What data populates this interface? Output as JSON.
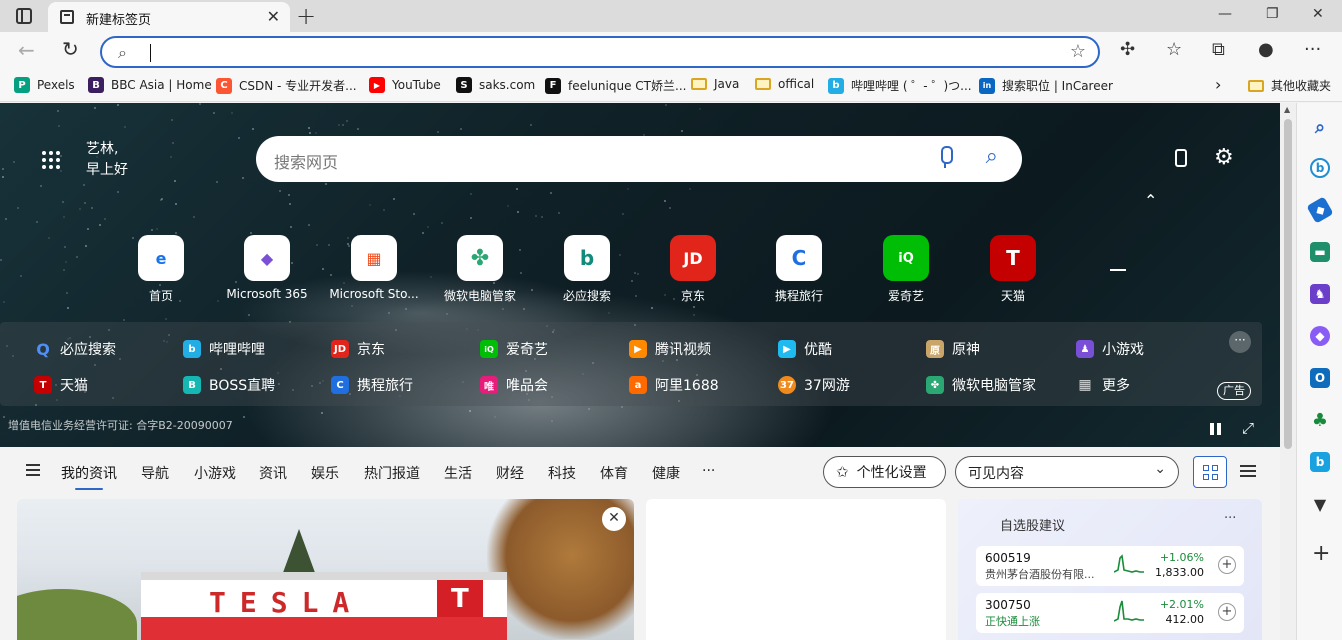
{
  "browser": {
    "tab_title": "新建标签页",
    "new_tab_glyph": "+",
    "close_glyph": "✕",
    "window_controls": {
      "minimize": "—",
      "restore": "❐",
      "close": "✕"
    },
    "address_value": ""
  },
  "bookmarks": [
    {
      "label": "Pexels",
      "icon": "pexels-icon",
      "color": "#05a081",
      "glyph": "P"
    },
    {
      "label": "BBC Asia | Home",
      "icon": "bbc-icon",
      "color": "#3b1f5e",
      "glyph": "B"
    },
    {
      "label": "CSDN - 专业开发者...",
      "icon": "csdn-icon",
      "color": "#fc5531",
      "glyph": "C"
    },
    {
      "label": "YouTube",
      "icon": "youtube-icon",
      "color": "#ff0000",
      "glyph": "▶"
    },
    {
      "label": "saks.com",
      "icon": "saks-icon",
      "color": "#111111",
      "glyph": "S"
    },
    {
      "label": "feelunique CT娇兰...",
      "icon": "feelunique-icon",
      "color": "#111111",
      "glyph": "F"
    },
    {
      "label": "Java",
      "icon": "folder-icon"
    },
    {
      "label": "offical",
      "icon": "folder-icon"
    },
    {
      "label": "哔哩哔哩 ( ゜- ゜)つ...",
      "icon": "bilibili-icon",
      "color": "#23ade5",
      "glyph": "b"
    },
    {
      "label": "搜索职位 | InCareer",
      "icon": "linkedin-icon",
      "color": "#0a66c2",
      "glyph": "in"
    }
  ],
  "bookmarks_overflow": "›",
  "other_favorites": "其他收藏夹",
  "hero": {
    "greeting_line1": "艺林,",
    "greeting_line2": "早上好",
    "search_placeholder": "搜索网页",
    "top_sites": [
      {
        "label": "首页",
        "glyph": "e",
        "color": "#1a73e8"
      },
      {
        "label": "Microsoft 365",
        "glyph": "◆",
        "color": "#7b4fd6"
      },
      {
        "label": "Microsoft Sto...",
        "glyph": "▦",
        "color": "#f25022"
      },
      {
        "label": "微软电脑管家",
        "glyph": "✤",
        "color": "#2aa772"
      },
      {
        "label": "必应搜索",
        "glyph": "b",
        "color": "#128a7c"
      },
      {
        "label": "京东",
        "glyph": "JD",
        "color": "#e1251b"
      },
      {
        "label": "携程旅行",
        "glyph": "C",
        "color": "#1f6fe0"
      },
      {
        "label": "爱奇艺",
        "glyph": "iQ",
        "color": "#00be06"
      },
      {
        "label": "天猫",
        "glyph": "T",
        "color": "#c40000"
      }
    ],
    "quick_links_row1": [
      {
        "label": "必应搜索",
        "glyph": "Q",
        "color": "#2f67c9"
      },
      {
        "label": "哔哩哔哩",
        "glyph": "b",
        "color": "#23ade5"
      },
      {
        "label": "京东",
        "glyph": "JD",
        "color": "#e1251b"
      },
      {
        "label": "爱奇艺",
        "glyph": "iQ",
        "color": "#00be06"
      },
      {
        "label": "腾讯视频",
        "glyph": "▶",
        "color": "#ff8a00"
      },
      {
        "label": "优酷",
        "glyph": "▶",
        "color": "#1ebaf0"
      },
      {
        "label": "原神",
        "glyph": "原",
        "color": "#c9a56a"
      },
      {
        "label": "小游戏",
        "glyph": "♟",
        "color": "#7a4fd8"
      }
    ],
    "quick_links_row2": [
      {
        "label": "天猫",
        "glyph": "T",
        "color": "#c40000"
      },
      {
        "label": "BOSS直聘",
        "glyph": "B",
        "color": "#14b7b1"
      },
      {
        "label": "携程旅行",
        "glyph": "C",
        "color": "#1f6fe0"
      },
      {
        "label": "唯品会",
        "glyph": "唯",
        "color": "#e61d7a"
      },
      {
        "label": "阿里1688",
        "glyph": "a",
        "color": "#ff6a00"
      },
      {
        "label": "37网游",
        "glyph": "37",
        "color": "#f08a1c"
      },
      {
        "label": "微软电脑管家",
        "glyph": "✤",
        "color": "#2aa772"
      },
      {
        "label": "更多",
        "glyph": "▦",
        "color": "#666666"
      }
    ],
    "more_glyph": "···",
    "ad_label": "广告",
    "license": "增值电信业务经营许可证: 合字B2-20090007"
  },
  "feed": {
    "tabs": [
      "我的资讯",
      "导航",
      "小游戏",
      "资讯",
      "娱乐",
      "热门报道",
      "生活",
      "财经",
      "科技",
      "体育",
      "健康",
      "···"
    ],
    "active_tab": "我的资讯",
    "personalize": "个性化设置",
    "visible_content": "可见内容",
    "news_store_text": "TESLA",
    "news_logo_text": "TESLA"
  },
  "stocks": {
    "title": "自选股建议",
    "more": "···",
    "items": [
      {
        "code": "600519",
        "name": "贵州茅台酒股份有限...",
        "change": "+1.06%",
        "price": "1,833.00"
      },
      {
        "code": "300750",
        "name": "正快通上涨",
        "change": "+2.01%",
        "price": "412.00"
      }
    ]
  },
  "colors": {
    "accent": "#2f67c9",
    "gain": "#1a8c3a"
  }
}
